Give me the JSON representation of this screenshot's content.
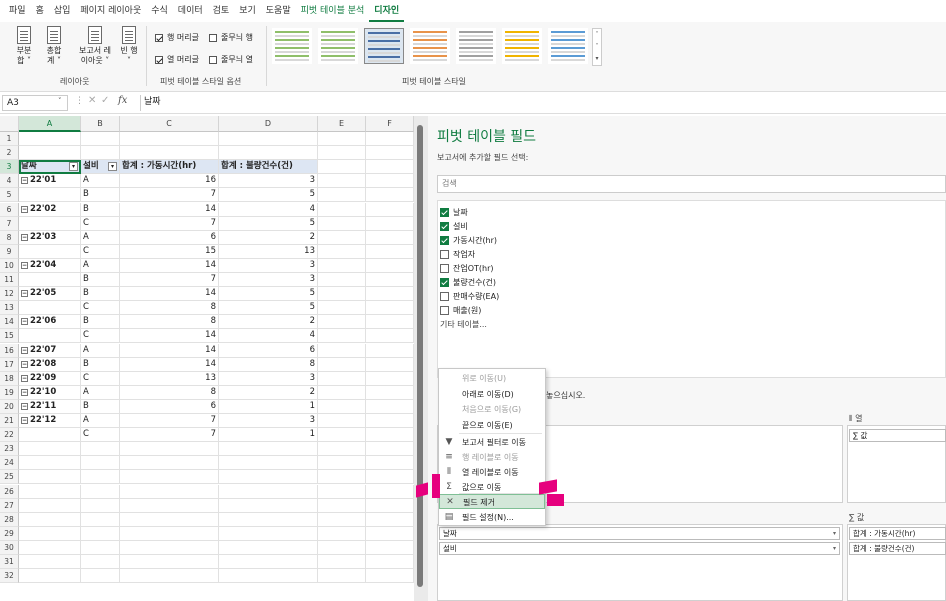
{
  "ribbon_tabs": [
    "파일",
    "홈",
    "삽입",
    "페이지 레이아웃",
    "수식",
    "데이터",
    "검토",
    "보기",
    "도움말",
    "피벗 테이블 분석",
    "디자인"
  ],
  "ribbon": {
    "subtotal": "부분\n합 ˅",
    "grandtotal": "총합\n계 ˅",
    "report_layout": "보고서 레\n이아웃 ˅",
    "blank_rows": "빈 행\n˅",
    "group_layout": "레이아웃",
    "opt_row_headers": "행 머리글",
    "opt_banded_rows": "줄무늬 행",
    "opt_col_headers": "열 머리글",
    "opt_banded_cols": "줄무늬 열",
    "group_style_options": "피벗 테이블 스타일 옵션",
    "group_styles": "피벗 테이블 스타일",
    "style_colors": [
      "#8fbf6a",
      "#8fbf6a",
      "#4a6fa5",
      "#e8934a",
      "#a0a0a0",
      "#f0b400",
      "#5b9bd5"
    ]
  },
  "formula_bar": {
    "cell_ref": "A3",
    "fx": "fx",
    "value": "날짜"
  },
  "columns": [
    "A",
    "B",
    "C",
    "D",
    "E",
    "F"
  ],
  "row_numbers": [
    "1",
    "2",
    "3",
    "4",
    "5",
    "6",
    "7",
    "8",
    "9",
    "10",
    "11",
    "12",
    "13",
    "14",
    "15",
    "16",
    "17",
    "18",
    "19",
    "20",
    "21",
    "22",
    "23",
    "24",
    "25",
    "26",
    "27",
    "28",
    "29",
    "30",
    "31",
    "32"
  ],
  "pivot": {
    "headers": [
      "날짜",
      "설비",
      "합계 : 가동시간(hr)",
      "합계 : 불량건수(건)"
    ],
    "rows": [
      {
        "date": "22'01",
        "eq": "A",
        "hours": "16",
        "defects": "3"
      },
      {
        "date": "",
        "eq": "B",
        "hours": "7",
        "defects": "5"
      },
      {
        "date": "22'02",
        "eq": "B",
        "hours": "14",
        "defects": "4"
      },
      {
        "date": "",
        "eq": "C",
        "hours": "7",
        "defects": "5"
      },
      {
        "date": "22'03",
        "eq": "A",
        "hours": "6",
        "defects": "2"
      },
      {
        "date": "",
        "eq": "C",
        "hours": "15",
        "defects": "13"
      },
      {
        "date": "22'04",
        "eq": "A",
        "hours": "14",
        "defects": "3"
      },
      {
        "date": "",
        "eq": "B",
        "hours": "7",
        "defects": "3"
      },
      {
        "date": "22'05",
        "eq": "B",
        "hours": "14",
        "defects": "5"
      },
      {
        "date": "",
        "eq": "C",
        "hours": "8",
        "defects": "5"
      },
      {
        "date": "22'06",
        "eq": "B",
        "hours": "8",
        "defects": "2"
      },
      {
        "date": "",
        "eq": "C",
        "hours": "14",
        "defects": "4"
      },
      {
        "date": "22'07",
        "eq": "A",
        "hours": "14",
        "defects": "6"
      },
      {
        "date": "22'08",
        "eq": "B",
        "hours": "14",
        "defects": "8"
      },
      {
        "date": "22'09",
        "eq": "C",
        "hours": "13",
        "defects": "3"
      },
      {
        "date": "22'10",
        "eq": "A",
        "hours": "8",
        "defects": "2"
      },
      {
        "date": "22'11",
        "eq": "B",
        "hours": "6",
        "defects": "1"
      },
      {
        "date": "22'12",
        "eq": "A",
        "hours": "7",
        "defects": "3"
      },
      {
        "date": "",
        "eq": "C",
        "hours": "7",
        "defects": "1"
      }
    ]
  },
  "pane": {
    "title": "피벗 테이블 필드",
    "subtitle": "보고서에 추가할 필드 선택:",
    "search_placeholder": "검색",
    "fields": [
      {
        "label": "날짜",
        "checked": true
      },
      {
        "label": "설비",
        "checked": true
      },
      {
        "label": "가동시간(hr)",
        "checked": true
      },
      {
        "label": "작업자",
        "checked": false
      },
      {
        "label": "잔업OT(hr)",
        "checked": false
      },
      {
        "label": "불량건수(건)",
        "checked": true
      },
      {
        "label": "판매수량(EA)",
        "checked": false
      },
      {
        "label": "매출(원)",
        "checked": false
      }
    ],
    "more_tables": "기타 테이블...",
    "drag_hint": "놓으십시오.",
    "col_area_label": "열",
    "col_area_item": "∑ 값",
    "values_area_label": "∑ 값",
    "row_items": [
      "날짜",
      "설비"
    ],
    "value_items": [
      "합계 : 가동시간(hr)",
      "합계 : 불량건수(건)"
    ]
  },
  "context_menu": [
    {
      "label": "위로 이동(U)",
      "disabled": true,
      "icon": ""
    },
    {
      "label": "아래로 이동(D)",
      "disabled": false,
      "icon": ""
    },
    {
      "label": "처음으로 이동(G)",
      "disabled": true,
      "icon": ""
    },
    {
      "label": "끝으로 이동(E)",
      "disabled": false,
      "icon": ""
    },
    {
      "label": "보고서 필터로 이동",
      "disabled": false,
      "icon": "filter-icon"
    },
    {
      "label": "행 레이블로 이동",
      "disabled": true,
      "icon": "rows-icon"
    },
    {
      "label": "열 레이블로 이동",
      "disabled": false,
      "icon": "columns-icon"
    },
    {
      "label": "값으로 이동",
      "disabled": false,
      "icon": "sigma-icon"
    },
    {
      "label": "필드 제거",
      "disabled": false,
      "icon": "remove-field-icon",
      "highlighted": true
    },
    {
      "label": "필드 설정(N)...",
      "disabled": false,
      "icon": "field-settings-icon"
    }
  ]
}
